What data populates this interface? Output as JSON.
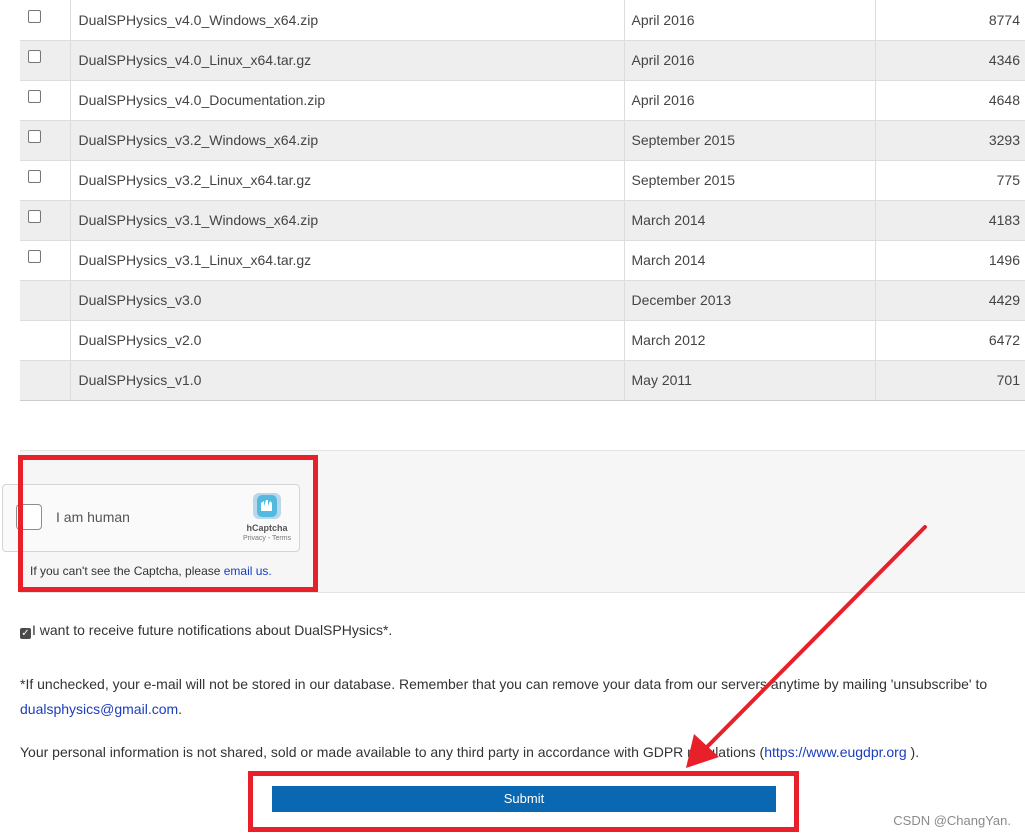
{
  "files": [
    {
      "name": "DualSPHysics_v4.0_Windows_x64.zip",
      "date": "April 2016",
      "count": "8774",
      "has_checkbox": true
    },
    {
      "name": "DualSPHysics_v4.0_Linux_x64.tar.gz",
      "date": "April 2016",
      "count": "4346",
      "has_checkbox": true
    },
    {
      "name": "DualSPHysics_v4.0_Documentation.zip",
      "date": "April 2016",
      "count": "4648",
      "has_checkbox": true
    },
    {
      "name": "DualSPHysics_v3.2_Windows_x64.zip",
      "date": "September 2015",
      "count": "3293",
      "has_checkbox": true
    },
    {
      "name": "DualSPHysics_v3.2_Linux_x64.tar.gz",
      "date": "September 2015",
      "count": "775",
      "has_checkbox": true
    },
    {
      "name": "DualSPHysics_v3.1_Windows_x64.zip",
      "date": "March 2014",
      "count": "4183",
      "has_checkbox": true
    },
    {
      "name": "DualSPHysics_v3.1_Linux_x64.tar.gz",
      "date": "March 2014",
      "count": "1496",
      "has_checkbox": true
    },
    {
      "name": "DualSPHysics_v3.0",
      "date": "December 2013",
      "count": "4429",
      "has_checkbox": false
    },
    {
      "name": "DualSPHysics_v2.0",
      "date": "March 2012",
      "count": "6472",
      "has_checkbox": false
    },
    {
      "name": "DualSPHysics_v1.0",
      "date": "May 2011",
      "count": "701",
      "has_checkbox": false
    }
  ],
  "captcha": {
    "label": "I am human",
    "brand": "hCaptcha",
    "links": "Privacy - Terms",
    "help_prefix": "If you can't see the Captcha, please ",
    "help_link": "email us."
  },
  "notify": {
    "checked": true,
    "label": "I want to receive future notifications about DualSPHysics*."
  },
  "disclaimer": {
    "text": "*If unchecked, your e-mail will not be stored in our database. Remember that you can remove your data from our servers anytime by mailing 'unsubscribe' to ",
    "email": "dualsphysics@gmail.com",
    "end": "."
  },
  "gdpr": {
    "text": "Your personal information is not shared, sold or made available to any third party in accordance with GDPR regulations (",
    "link": "https://www.eugdpr.org",
    "end": " )."
  },
  "submit_label": "Submit",
  "watermark": "CSDN @ChangYan.",
  "colors": {
    "annotation": "#e8202a",
    "submit": "#0a68b3",
    "link": "#1a3dbd"
  }
}
